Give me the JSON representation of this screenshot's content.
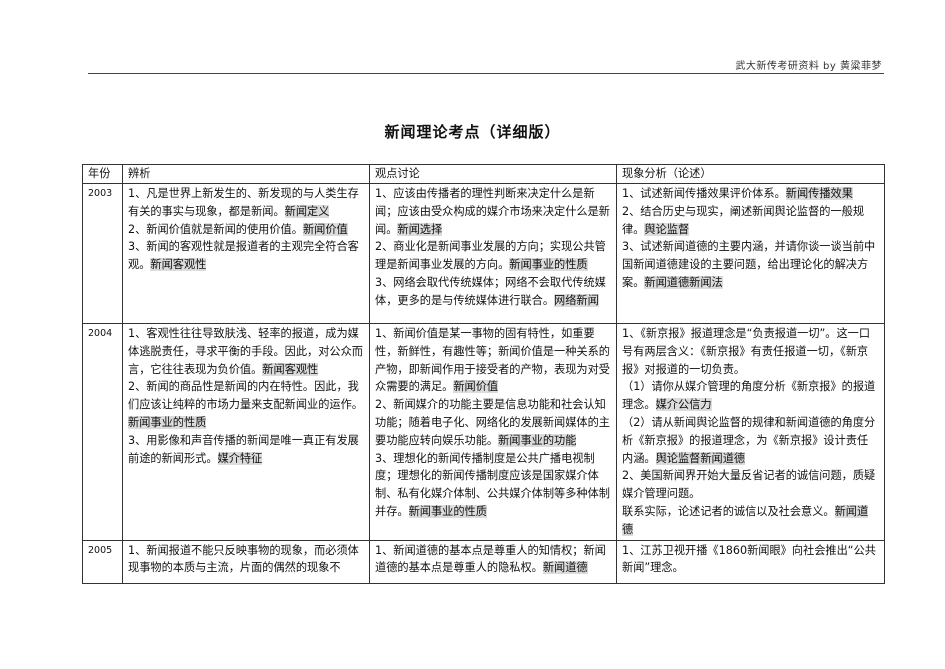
{
  "header_text": "武大新传考研资料 by 黄粱菲梦",
  "title": "新闻理论考点（详细版）",
  "columns": [
    "年份",
    "辨析",
    "观点讨论",
    "现象分析（论述）"
  ],
  "rows": [
    {
      "year": "2003",
      "analysis": [
        {
          "text": "1、凡是世界上新发生的、新发现的与人类生存有关的事实与现象，都是新闻。",
          "tag": "新闻定义"
        },
        {
          "text": "2、新闻价值就是新闻的使用价值。",
          "tag": "新闻价值"
        },
        {
          "text": "3、新闻的客观性就是报道者的主观完全符合客观。",
          "tag": "新闻客观性"
        }
      ],
      "discussion": [
        {
          "text": "1、应该由传播者的理性判断来决定什么是新闻；应该由受众构成的媒介市场来决定什么是新闻。",
          "tag": "新闻选择"
        },
        {
          "text": "2、商业化是新闻事业发展的方向；实现公共管理是新闻事业发展的方向。",
          "tag": "新闻事业的性质"
        },
        {
          "text": "3、网络会取代传统媒体；网络不会取代传统媒体，更多的是与传统媒体进行联合。",
          "tag": "网络新闻"
        }
      ],
      "phenomenon": [
        {
          "text": "1、试述新闻传播效果评价体系。",
          "tag": "新闻传播效果"
        },
        {
          "text": "2、结合历史与现实，阐述新闻舆论监督的一般规律。",
          "tag": "舆论监督"
        },
        {
          "text": "3、试述新闻道德的主要内涵，并请你谈一谈当前中国新闻道德建设的主要问题，给出理论化的解决方案。",
          "tag": "新闻道德新闻法"
        }
      ]
    },
    {
      "year": "2004",
      "analysis": [
        {
          "text": "1、客观性往往导致肤浅、轻率的报道，成为媒体逃脱责任，寻求平衡的手段。因此，对公众而言，它往往表现为负价值。",
          "tag": "新闻客观性"
        },
        {
          "text": "2、新闻的商品性是新闻的内在特性。因此，我们应该让纯粹的市场力量来支配新闻业的运作。",
          "tag": "新闻事业的性质"
        },
        {
          "text": "3、用影像和声音传播的新闻是唯一真正有发展前途的新闻形式。",
          "tag": "媒介特征"
        }
      ],
      "discussion": [
        {
          "text": "1、新闻价值是某一事物的固有特性，如重要性，新鲜性，有趣性等；新闻价值是一种关系的产物，即新闻作用于接受者的产物，表现为对受众需要的满足。",
          "tag": "新闻价值"
        },
        {
          "text": "2、新闻媒介的功能主要是信息功能和社会认知功能；随着电子化、网络化的发展新闻媒体的主要功能应转向娱乐功能。",
          "tag": "新闻事业的功能"
        },
        {
          "text": "3、理想化的新闻传播制度是公共广播电视制度；理想化的新闻传播制度应该是国家媒介体制、私有化媒介体制、公共媒介体制等多种体制并存。",
          "tag": "新闻事业的性质"
        }
      ],
      "phenomenon": [
        {
          "text": "1、《新京报》报道理念是“负责报道一切”。这一口号有两层含义：《新京报》有责任报道一切，《新京报》对报道的一切负责。",
          "tag": ""
        },
        {
          "text": "（1）请你从媒介管理的角度分析《新京报》的报道理念。",
          "tag": "媒介公信力"
        },
        {
          "text": "（2）请从新闻舆论监督的规律和新闻道德的角度分析《新京报》的报道理念，为《新京报》设计责任内涵。",
          "tag": "舆论监督新闻道德"
        },
        {
          "text": "2、美国新闻界开始大量反省记者的诚信问题，质疑媒介管理问题。",
          "tag": ""
        },
        {
          "text": "联系实际，论述记者的诚信以及社会意义。",
          "tag": "新闻道德"
        }
      ]
    },
    {
      "year": "2005",
      "analysis": [
        {
          "text": "1、新闻报道不能只反映事物的现象，而必须体现事物的本质与主流，片面的偶然的现象不",
          "tag": ""
        }
      ],
      "discussion": [
        {
          "text": "1、新闻道德的基本点是尊重人的知情权；新闻道德的基本点是尊重人的隐私权。",
          "tag": "新闻道德"
        }
      ],
      "phenomenon": [
        {
          "text": "1、江苏卫视开播《1860新闻眼》向社会推出“公共新闻”理念。",
          "tag": ""
        }
      ]
    }
  ]
}
